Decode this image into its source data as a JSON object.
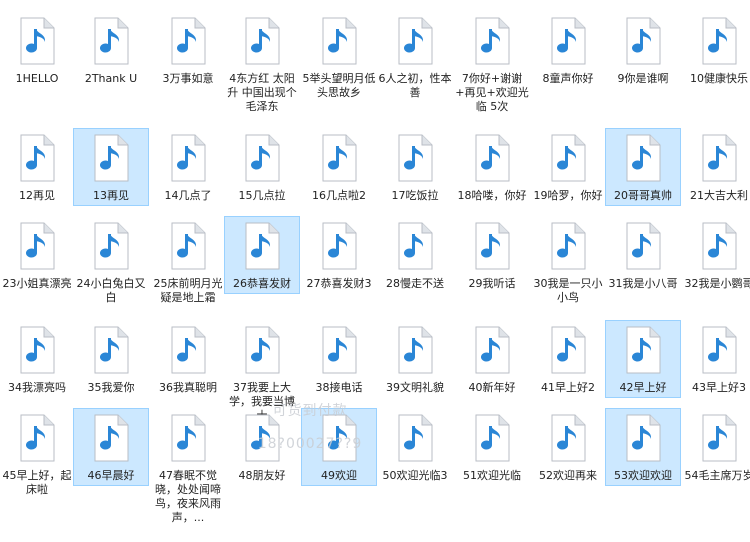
{
  "folder": {
    "colors": {
      "icon_page": "#ffffff",
      "icon_border": "#b9bec6",
      "icon_fold": "#dfe3e8",
      "music_note": "#2a86d6",
      "selection_fill": "#cce8ff",
      "selection_border": "#99d1ff",
      "label_text": "#222222"
    },
    "file_icon": "music-file-icon",
    "files": [
      {
        "label": "1HELLO",
        "selected": false
      },
      {
        "label": "2Thank U",
        "selected": false
      },
      {
        "label": "3万事如意",
        "selected": false
      },
      {
        "label": "4东方红 太阳升 中国出现个毛泽东",
        "selected": false
      },
      {
        "label": "5举头望明月低头思故乡",
        "selected": false
      },
      {
        "label": "6人之初，性本善",
        "selected": false
      },
      {
        "label": "7你好+谢谢+再见+欢迎光临 5次",
        "selected": false
      },
      {
        "label": "8童声你好",
        "selected": false
      },
      {
        "label": "9你是谁啊",
        "selected": false
      },
      {
        "label": "10健康快乐",
        "selected": false
      },
      {
        "label": "12再见",
        "selected": false
      },
      {
        "label": "13再见",
        "selected": true
      },
      {
        "label": "14几点了",
        "selected": false
      },
      {
        "label": "15几点拉",
        "selected": false
      },
      {
        "label": "16几点啦2",
        "selected": false
      },
      {
        "label": "17吃饭拉",
        "selected": false
      },
      {
        "label": "18哈喽，你好",
        "selected": false
      },
      {
        "label": "19哈罗，你好",
        "selected": false
      },
      {
        "label": "20哥哥真帅",
        "selected": true
      },
      {
        "label": "21大吉大利",
        "selected": false
      },
      {
        "label": "23小姐真漂亮",
        "selected": false
      },
      {
        "label": "24小白兔白又白",
        "selected": false
      },
      {
        "label": "25床前明月光 疑是地上霜",
        "selected": false
      },
      {
        "label": "26恭喜发财",
        "selected": true
      },
      {
        "label": "27恭喜发财3",
        "selected": false
      },
      {
        "label": "28慢走不送",
        "selected": false
      },
      {
        "label": "29我听话",
        "selected": false
      },
      {
        "label": "30我是一只小小鸟",
        "selected": false
      },
      {
        "label": "31我是小八哥",
        "selected": false
      },
      {
        "label": "32我是小鹦哥",
        "selected": false
      },
      {
        "label": "34我漂亮吗",
        "selected": false
      },
      {
        "label": "35我爱你",
        "selected": false
      },
      {
        "label": "36我真聪明",
        "selected": false
      },
      {
        "label": "37我要上大学，我要当博士",
        "selected": false
      },
      {
        "label": "38接电话",
        "selected": false
      },
      {
        "label": "39文明礼貌",
        "selected": false
      },
      {
        "label": "40新年好",
        "selected": false
      },
      {
        "label": "41早上好2",
        "selected": false
      },
      {
        "label": "42早上好",
        "selected": true
      },
      {
        "label": "43早上好3",
        "selected": false
      },
      {
        "label": "45早上好，起床啦",
        "selected": false
      },
      {
        "label": "46早晨好",
        "selected": true
      },
      {
        "label": "47春眠不觉晓，处处闻啼鸟，夜来风雨声，...",
        "selected": false
      },
      {
        "label": "48朋友好",
        "selected": false
      },
      {
        "label": "49欢迎",
        "selected": true
      },
      {
        "label": "50欢迎光临3",
        "selected": false
      },
      {
        "label": "51欢迎光临",
        "selected": false
      },
      {
        "label": "52欢迎再来",
        "selected": false
      },
      {
        "label": "53欢迎欢迎",
        "selected": true
      },
      {
        "label": "54毛主席万岁",
        "selected": false
      }
    ]
  },
  "watermark": {
    "line1": "可货到付款",
    "line2": "18?00027??9"
  }
}
